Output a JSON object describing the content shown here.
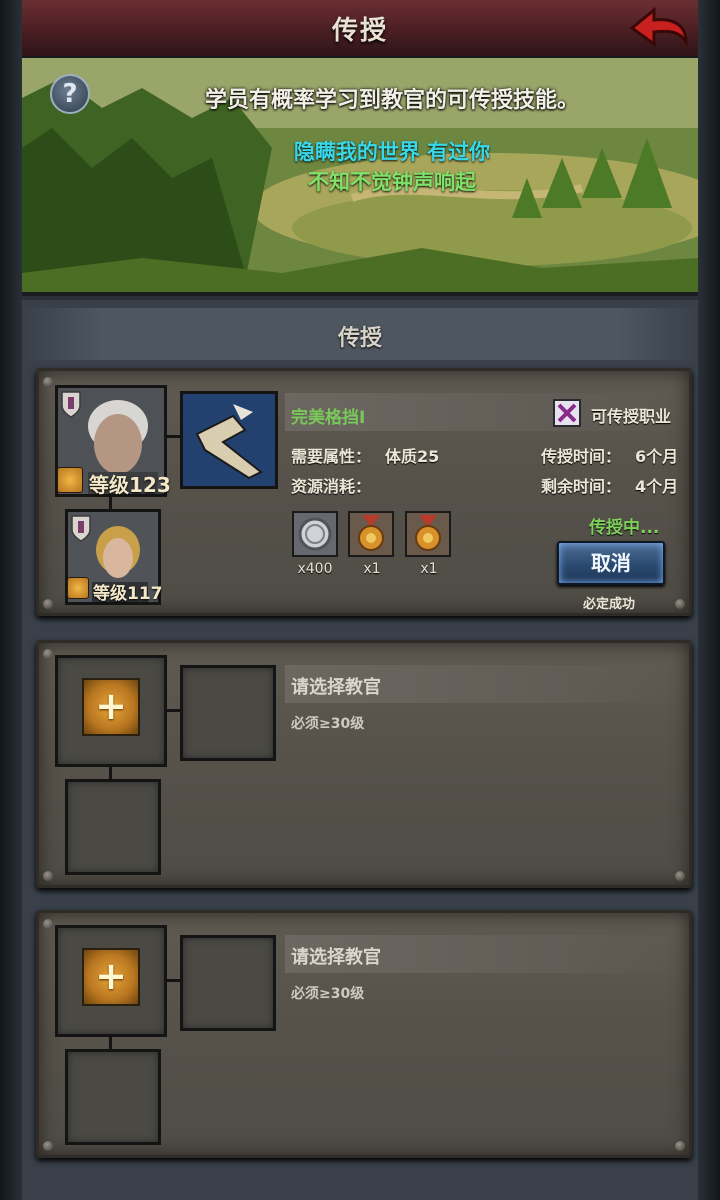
{
  "header": {
    "title": "传授"
  },
  "banner": {
    "info": "学员有概率学习到教官的可传授技能。",
    "lyric_line1": "隐瞒我的世界 有过你",
    "lyric_line2": "不知不觉钟声响起"
  },
  "section": {
    "title": "传授"
  },
  "active_card": {
    "teacher_level_label": "等级",
    "teacher_level": "123",
    "student_level_label": "等级",
    "student_level": "117",
    "skill_name": "完美格挡I",
    "transferable_label": "可传授职业",
    "required_attr_label": "需要属性：",
    "required_attr_value": "体质25",
    "resource_label": "资源消耗：",
    "teach_time_label": "传授时间：",
    "teach_time_value": "6个月",
    "remaining_time_label": "剩余时间：",
    "remaining_time_value": "4个月",
    "resources": [
      {
        "icon": "silver-coin-icon",
        "count": "x400"
      },
      {
        "icon": "medal-icon",
        "count": "x1"
      },
      {
        "icon": "medal-icon",
        "count": "x1"
      }
    ],
    "status": "传授中...",
    "cancel_label": "取消",
    "success_note": "必定成功"
  },
  "empty_cards": [
    {
      "choose": "请选择教官",
      "requirement": "必须≥30级"
    },
    {
      "choose": "请选择教官",
      "requirement": "必须≥30级"
    }
  ],
  "colors": {
    "header": "#4a1f24",
    "skill_name": "#79c85a",
    "status": "#7fd15b",
    "lyric1": "#38d8e8",
    "lyric2": "#7fe06a"
  }
}
